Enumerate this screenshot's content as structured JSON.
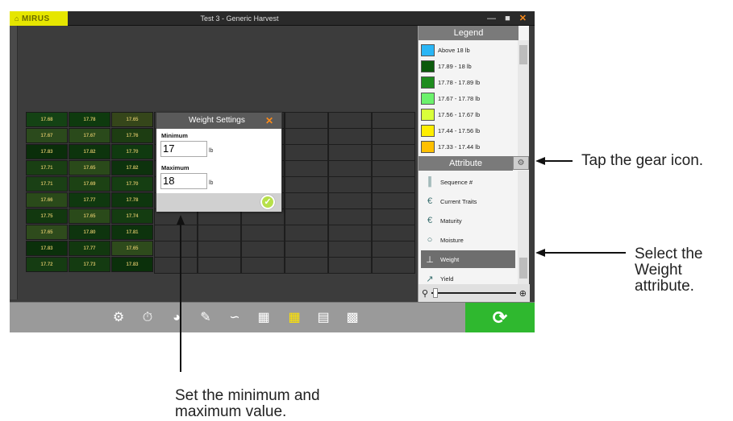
{
  "window": {
    "title": "Test 3 - Generic Harvest",
    "logo": "MIRUS"
  },
  "legend": {
    "title": "Legend",
    "items": [
      {
        "label": "Above 18 lb",
        "color": "#29b6f6"
      },
      {
        "label": "17.89 - 18 lb",
        "color": "#0b5a0b"
      },
      {
        "label": "17.78 - 17.89 lb",
        "color": "#1e8c1e"
      },
      {
        "label": "17.67 - 17.78 lb",
        "color": "#6cf26c"
      },
      {
        "label": "17.56 - 17.67 lb",
        "color": "#d9ff3a"
      },
      {
        "label": "17.44 - 17.56 lb",
        "color": "#ffee00"
      },
      {
        "label": "17.33 - 17.44 lb",
        "color": "#ffc000"
      }
    ]
  },
  "attribute": {
    "title": "Attribute",
    "items": [
      {
        "label": "Sequence #",
        "icon": "barcode-icon"
      },
      {
        "label": "Current Traits",
        "icon": "trait-icon"
      },
      {
        "label": "Maturity",
        "icon": "maturity-icon"
      },
      {
        "label": "Moisture",
        "icon": "water-drop-icon"
      },
      {
        "label": "Weight",
        "icon": "weight-icon",
        "selected": true
      },
      {
        "label": "Yield",
        "icon": "yield-icon"
      }
    ]
  },
  "grid": {
    "rows": [
      [
        "17.68",
        "17.78",
        "17.65"
      ],
      [
        "17.67",
        "17.67",
        "17.76"
      ],
      [
        "17.83",
        "17.82",
        "17.70"
      ],
      [
        "17.71",
        "17.65",
        "17.82"
      ],
      [
        "17.71",
        "17.69",
        "17.70"
      ],
      [
        "17.66",
        "17.77",
        "17.78"
      ],
      [
        "17.75",
        "17.65",
        "17.74"
      ],
      [
        "17.65",
        "17.80",
        "17.81"
      ],
      [
        "17.83",
        "17.77",
        "17.65"
      ],
      [
        "17.72",
        "17.73",
        "17.83"
      ]
    ],
    "colors": [
      [
        "#144214",
        "#0e3a0e",
        "#35461a"
      ],
      [
        "#2b4a1c",
        "#2a4a1b",
        "#1d3d12"
      ],
      [
        "#0a2e0a",
        "#0d340d",
        "#103a10"
      ],
      [
        "#193f13",
        "#2a4a1a",
        "#0d320d"
      ],
      [
        "#1a4015",
        "#1c4214",
        "#153e12"
      ],
      [
        "#2a4a1a",
        "#0f380f",
        "#0e360e"
      ],
      [
        "#12380f",
        "#2a4a1a",
        "#143c11"
      ],
      [
        "#2e4b1c",
        "#0e340e",
        "#0d330d"
      ],
      [
        "#0b300b",
        "#12380f",
        "#2e4b1c"
      ],
      [
        "#153c12",
        "#143b11",
        "#0b300b"
      ]
    ]
  },
  "dialog": {
    "title": "Weight Settings",
    "min_label": "Minimum",
    "min_value": "17",
    "max_label": "Maximum",
    "max_value": "18",
    "unit": "lb"
  },
  "annotations": {
    "gear": "Tap the gear icon.",
    "weight": "Select the Weight attribute.",
    "minmax": "Set the minimum and maximum value."
  }
}
